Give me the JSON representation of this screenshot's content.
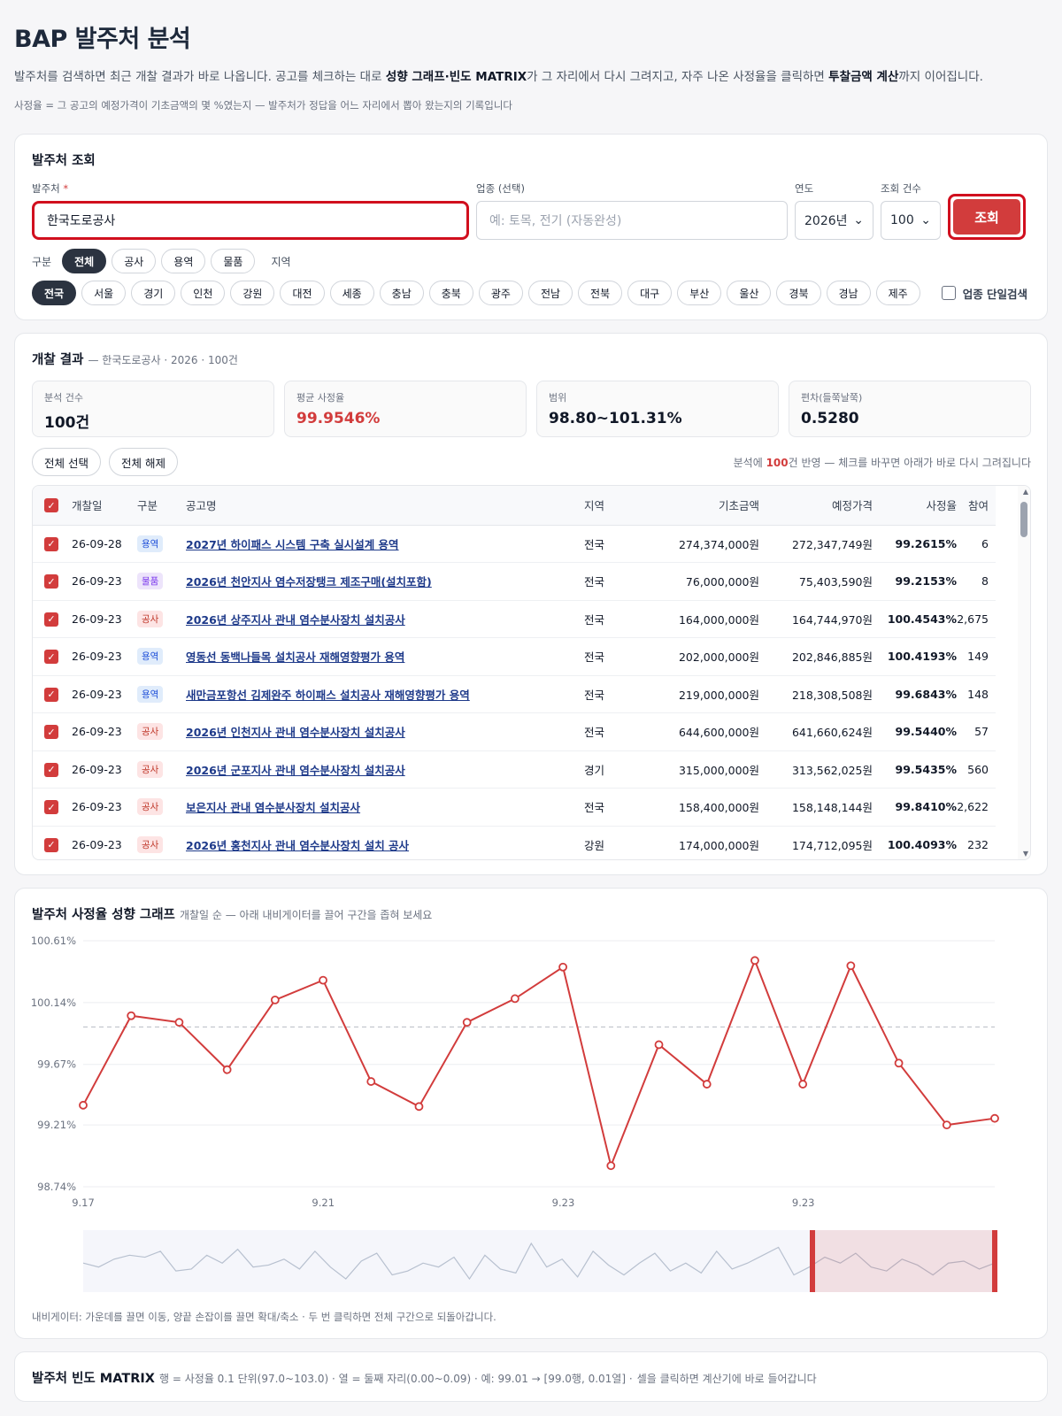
{
  "page": {
    "title": "BAP 발주처 분석",
    "desc_parts": [
      "발주처를 검색하면 최근 개찰 결과가 바로 나옵니다. 공고를 체크하는 대로 ",
      "성향 그래프·빈도 MATRIX",
      "가 그 자리에서 다시 그려지고, 자주 나온 사정율을 클릭하면 ",
      "투찰금액 계산",
      "까지 이어집니다."
    ],
    "note": "사정율 = 그 공고의 예정가격이 기초금액의 몇 %였는지 — 발주처가 정답을 어느 자리에서 뽑아 왔는지의 기록입니다"
  },
  "search": {
    "title": "발주처 조회",
    "agency_label": "발주처",
    "agency_required": "*",
    "agency_value": "한국도로공사",
    "sector_label": "업종 (선택)",
    "sector_placeholder": "예: 토목, 전기 (자동완성)",
    "year_label": "연도",
    "year_value": "2026년",
    "count_label": "조회 건수",
    "count_value": "100",
    "submit_label": "조회",
    "type_label": "구분",
    "types": [
      "전체",
      "공사",
      "용역",
      "물품"
    ],
    "region_label": "지역",
    "regions": [
      "전국",
      "서울",
      "경기",
      "인천",
      "강원",
      "대전",
      "세종",
      "충남",
      "충북",
      "광주",
      "전남",
      "전북",
      "대구",
      "부산",
      "울산",
      "경북",
      "경남",
      "제주"
    ],
    "single_search_label": "업종 단일검색"
  },
  "results": {
    "title": "개찰 결과",
    "subtitle": "— 한국도로공사 · 2026 · 100건",
    "stats": [
      {
        "label": "분석 건수",
        "value": "100건"
      },
      {
        "label": "평균 사정율",
        "value": "99.9546%"
      },
      {
        "label": "범위",
        "value": "98.80~101.31%"
      },
      {
        "label": "편차(들쭉날쭉)",
        "value": "0.5280"
      }
    ],
    "select_all": "전체 선택",
    "deselect_all": "전체 해제",
    "note_prefix": "분석에 ",
    "note_count": "100",
    "note_suffix": "건 반영 — 체크를 바꾸면 아래가 바로 다시 그려집니다",
    "columns": [
      "개찰일",
      "구분",
      "공고명",
      "지역",
      "기초금액",
      "예정가격",
      "사정율",
      "참여"
    ],
    "rows": [
      {
        "date": "26-09-28",
        "type": "용역",
        "title": "2027년 하이패스 시스템 구축 실시설계 용역",
        "region": "전국",
        "base": "274,374,000원",
        "est": "272,347,749원",
        "rate": "99.2615%",
        "part": "6"
      },
      {
        "date": "26-09-23",
        "type": "물품",
        "title": "2026년 천안지사 염수저장탱크 제조구매(설치포함)",
        "region": "전국",
        "base": "76,000,000원",
        "est": "75,403,590원",
        "rate": "99.2153%",
        "part": "8"
      },
      {
        "date": "26-09-23",
        "type": "공사",
        "title": "2026년 상주지사 관내 염수분사장치 설치공사",
        "region": "전국",
        "base": "164,000,000원",
        "est": "164,744,970원",
        "rate": "100.4543%",
        "part": "2,675"
      },
      {
        "date": "26-09-23",
        "type": "용역",
        "title": "영동선 동백나들목 설치공사 재해영향평가 용역",
        "region": "전국",
        "base": "202,000,000원",
        "est": "202,846,885원",
        "rate": "100.4193%",
        "part": "149"
      },
      {
        "date": "26-09-23",
        "type": "용역",
        "title": "새만금포항선 김제완주 하이패스 설치공사 재해영향평가 용역",
        "region": "전국",
        "base": "219,000,000원",
        "est": "218,308,508원",
        "rate": "99.6843%",
        "part": "148"
      },
      {
        "date": "26-09-23",
        "type": "공사",
        "title": "2026년 인천지사 관내 염수분사장치 설치공사",
        "region": "전국",
        "base": "644,600,000원",
        "est": "641,660,624원",
        "rate": "99.5440%",
        "part": "57"
      },
      {
        "date": "26-09-23",
        "type": "공사",
        "title": "2026년 군포지사 관내 염수분사장치 설치공사",
        "region": "경기",
        "base": "315,000,000원",
        "est": "313,562,025원",
        "rate": "99.5435%",
        "part": "560"
      },
      {
        "date": "26-09-23",
        "type": "공사",
        "title": "보은지사 관내 염수분사장치 설치공사",
        "region": "전국",
        "base": "158,400,000원",
        "est": "158,148,144원",
        "rate": "99.8410%",
        "part": "2,622"
      },
      {
        "date": "26-09-23",
        "type": "공사",
        "title": "2026년 홍천지사 관내 염수분사장치 설치 공사",
        "region": "강원",
        "base": "174,000,000원",
        "est": "174,712,095원",
        "rate": "100.4093%",
        "part": "232"
      }
    ]
  },
  "trend": {
    "title": "발주처 사정율 성향 그래프",
    "subtitle": "개찰일 순 — 아래 내비게이터를 끌어 구간을 좁혀 보세요",
    "nav_help": "내비게이터: 가운데를 끌면 이동, 양끝 손잡이를 끌면 확대/축소 · 두 번 클릭하면 전체 구간으로 되돌아갑니다."
  },
  "chart_data": {
    "type": "line",
    "y_tick_labels": [
      "100.61%",
      "100.14%",
      "99.67%",
      "99.21%",
      "98.74%"
    ],
    "y_ticks": [
      100.61,
      100.14,
      99.67,
      99.21,
      98.74
    ],
    "ylim": [
      98.74,
      100.61
    ],
    "x_tick_labels": [
      "9.17",
      "9.21",
      "9.23",
      "9.23"
    ],
    "mean": 99.9546,
    "values": [
      99.36,
      100.04,
      99.99,
      99.63,
      100.16,
      100.31,
      99.54,
      99.35,
      99.99,
      100.17,
      100.41,
      98.9,
      99.82,
      99.52,
      100.46,
      99.52,
      100.42,
      99.68,
      99.21,
      99.26
    ],
    "grid": true,
    "navigator": {
      "values": [
        99.6,
        99.5,
        99.7,
        99.8,
        99.75,
        99.9,
        99.4,
        99.45,
        99.8,
        99.6,
        99.95,
        99.5,
        99.55,
        99.7,
        99.45,
        99.9,
        99.5,
        99.2,
        99.65,
        99.85,
        99.3,
        99.4,
        99.6,
        99.5,
        99.75,
        99.2,
        99.8,
        99.45,
        99.35,
        100.1,
        99.5,
        99.7,
        99.25,
        99.9,
        99.55,
        99.3,
        99.6,
        99.85,
        99.4,
        99.6,
        99.35,
        99.9,
        99.45,
        99.6,
        99.8,
        100.0,
        99.3,
        99.5,
        99.75,
        99.6,
        99.85,
        99.5,
        99.4,
        99.7,
        99.55,
        99.3,
        99.6,
        99.65,
        99.45,
        99.6
      ],
      "selection": [
        0.8,
        1.0
      ]
    }
  },
  "matrix": {
    "title": "발주처 빈도 MATRIX",
    "subtitle": "행 = 사정율 0.1 단위(97.0~103.0) · 열 = 둘째 자리(0.00~0.09) · 예: 99.01 → [99.0행, 0.01열] ·",
    "subtitle_red": "셀을 클릭하면 계산기에 바로 들어갑니다"
  },
  "colors": {
    "accent": "#d23c3c",
    "highlight": "#d10f1e",
    "dark": "#2b3340"
  }
}
